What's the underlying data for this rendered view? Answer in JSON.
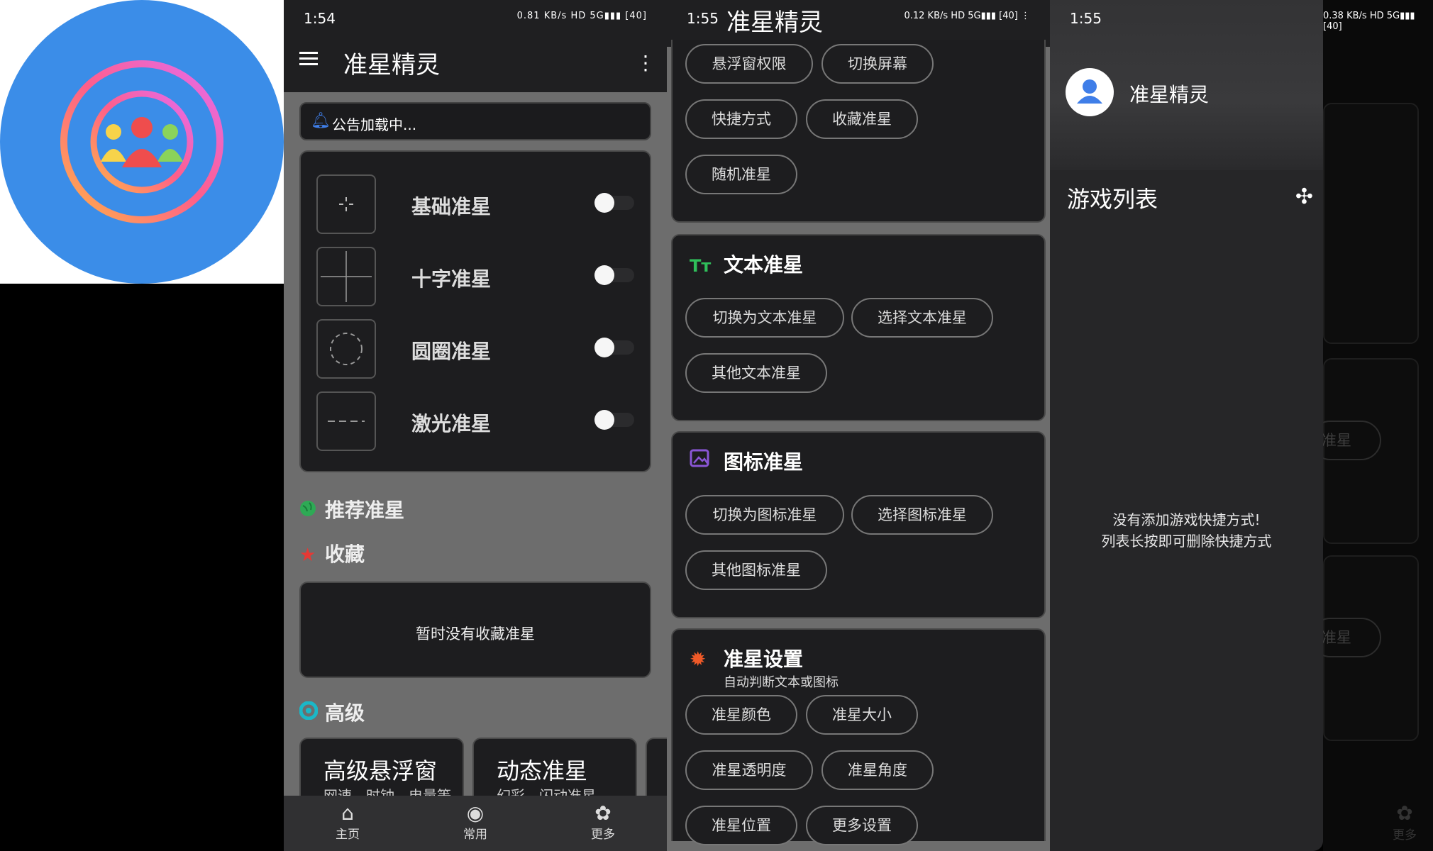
{
  "status": {
    "time_p1": "1:54",
    "time_p2": "1:55",
    "time_p3": "1:55",
    "net_p1": "0.81 KB/s",
    "net_p2": "0.12 KB/s",
    "net_p3": "0.38 KB/s",
    "battery": "40"
  },
  "app_title": "准星精灵",
  "notice": {
    "text": "公告加载中..."
  },
  "crosshairs": [
    {
      "label": "基础准星",
      "enabled": false
    },
    {
      "label": "十字准星",
      "enabled": false
    },
    {
      "label": "圆圈准星",
      "enabled": false
    },
    {
      "label": "激光准星",
      "enabled": false
    }
  ],
  "sections": {
    "recommended": "推荐准星",
    "favorites": "收藏",
    "favorites_empty": "暂时没有收藏准星",
    "advanced": "高级"
  },
  "advanced_cards": [
    {
      "title": "高级悬浮窗",
      "subtitle": "网速、时钟、电量等"
    },
    {
      "title": "动态准星",
      "subtitle": "幻彩、闪动准星"
    }
  ],
  "bottom_nav": [
    {
      "label": "主页",
      "icon": "home-icon"
    },
    {
      "label": "常用",
      "icon": "palette-icon"
    },
    {
      "label": "更多",
      "icon": "gear-icon"
    }
  ],
  "panel2": {
    "top_chips": [
      "悬浮窗权限",
      "切换屏幕",
      "快捷方式",
      "收藏准星",
      "随机准星"
    ],
    "text_group": {
      "title": "文本准星",
      "icon_text": "Tт",
      "chips": [
        "切换为文本准星",
        "选择文本准星",
        "其他文本准星"
      ]
    },
    "icon_group": {
      "title": "图标准星",
      "chips": [
        "切换为图标准星",
        "选择图标准星",
        "其他图标准星"
      ]
    },
    "settings_group": {
      "title": "准星设置",
      "subtitle": "自动判断文本或图标",
      "chips": [
        "准星颜色",
        "准星大小",
        "准星透明度",
        "准星角度",
        "准星位置",
        "更多设置"
      ]
    }
  },
  "drawer": {
    "name": "准星精灵",
    "game_list_title": "游戏列表",
    "empty_line1": "没有添加游戏快捷方式!",
    "empty_line2": "列表长按即可删除快捷方式",
    "ghost_chip": "准星",
    "ghost_nav": "更多"
  },
  "colors": {
    "logo_bg": "#3b8de8",
    "accent_blue": "#3f7ee8",
    "text_green": "#2fbf5a",
    "icon_purple": "#8a56d6",
    "settings_orange": "#f05a28",
    "star_red": "#e53935",
    "globe_green": "#2eaa55",
    "adv_teal": "#1ab8c8"
  }
}
